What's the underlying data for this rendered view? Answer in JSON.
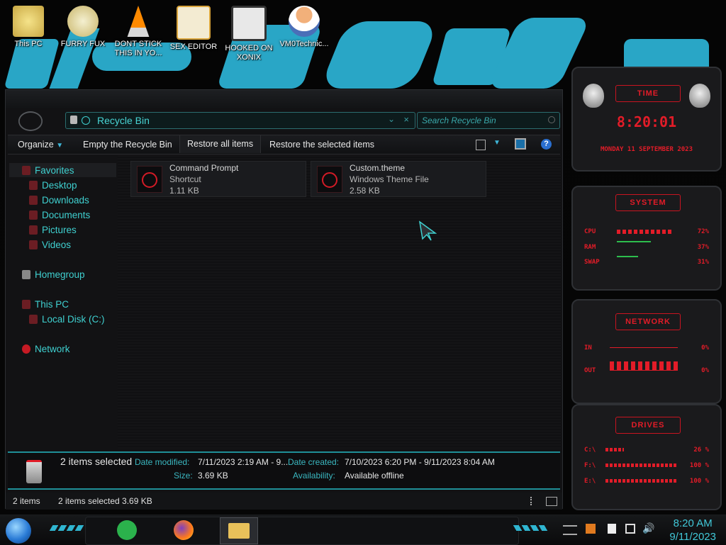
{
  "desktop": {
    "icons": [
      {
        "label": "This PC"
      },
      {
        "label": "FURRY FUX"
      },
      {
        "label": "DONT STICK THIS IN YO..."
      },
      {
        "label": "SEX EDITOR"
      },
      {
        "label": "HOOKED ON XONIX"
      },
      {
        "label": "VM0Technic..."
      }
    ]
  },
  "explorer": {
    "address": "Recycle Bin",
    "search_placeholder": "Search Recycle Bin",
    "toolbar": {
      "organize": "Organize",
      "empty": "Empty the Recycle Bin",
      "restore_all": "Restore all items",
      "restore_selected": "Restore the selected items"
    },
    "nav": {
      "favorites": "Favorites",
      "desktop": "Desktop",
      "downloads": "Downloads",
      "documents": "Documents",
      "pictures": "Pictures",
      "videos": "Videos",
      "homegroup": "Homegroup",
      "this_pc": "This PC",
      "local_disk": "Local Disk (C:)",
      "network": "Network"
    },
    "items": [
      {
        "name": "Command Prompt",
        "type": "Shortcut",
        "size": "1.11 KB"
      },
      {
        "name": "Custom.theme",
        "type": "Windows Theme File",
        "size": "2.58 KB"
      }
    ],
    "details": {
      "selection": "2 items selected",
      "date_modified_label": "Date modified:",
      "date_modified_value": "7/11/2023 2:19 AM - 9...",
      "date_created_label": "Date created:",
      "date_created_value": "7/10/2023 6:20 PM - 9/11/2023 8:04 AM",
      "size_label": "Size:",
      "size_value": "3.69 KB",
      "availability_label": "Availability:",
      "availability_value": "Available offline"
    },
    "status": {
      "count": "2 items",
      "selected": "2 items selected  3.69 KB"
    }
  },
  "gadgets": {
    "time": {
      "title": "TIME",
      "clock": "8:20:01",
      "date": "MONDAY 11 SEPTEMBER 2023"
    },
    "system": {
      "title": "SYSTEM",
      "rows": [
        {
          "label": "CPU",
          "value": "72%"
        },
        {
          "label": "RAM",
          "value": "37%"
        },
        {
          "label": "SWAP",
          "value": "31%"
        }
      ]
    },
    "network": {
      "title": "NETWORK",
      "rows": [
        {
          "label": "IN",
          "value": "0%"
        },
        {
          "label": "OUT",
          "value": "0%"
        }
      ]
    },
    "drives": {
      "title": "DRIVES",
      "rows": [
        {
          "label": "C:\\",
          "value": "26 %"
        },
        {
          "label": "F:\\",
          "value": "100 %"
        },
        {
          "label": "E:\\",
          "value": "100 %"
        }
      ]
    }
  },
  "taskbar": {
    "time": "8:20 AM",
    "date": "9/11/2023"
  },
  "colors": {
    "accent": "#3fd0d0",
    "alienware_red": "#e21c28"
  }
}
